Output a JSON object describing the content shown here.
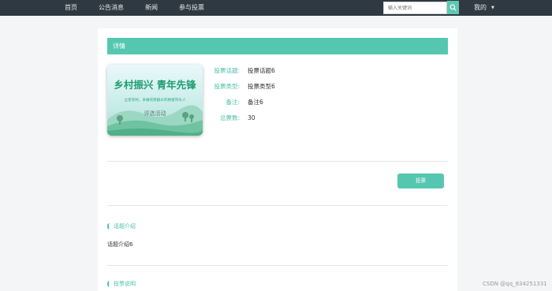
{
  "nav": {
    "items": [
      {
        "label": "首页"
      },
      {
        "label": "公告消息"
      },
      {
        "label": "新闻"
      },
      {
        "label": "参与投票"
      }
    ],
    "search_placeholder": "输入关键词",
    "search_icon": "search-icon",
    "mine_label": "我的",
    "mine_caret": "▼"
  },
  "detail": {
    "header": "详情",
    "cover": {
      "title": "乡村振兴 青年先锋",
      "subtitle": "立足农村，争做农民群众的致富带头人",
      "badge": "评选活动"
    },
    "fields": [
      {
        "key": "投票话题:",
        "value": "投票话题6"
      },
      {
        "key": "投票类型:",
        "value": "投票类型6"
      },
      {
        "key": "备注:",
        "value": "备注6"
      },
      {
        "key": "总票数:",
        "value": "30"
      }
    ],
    "vote_button": "投票"
  },
  "sections": [
    {
      "title": "话题介绍",
      "body": "话题介绍6"
    },
    {
      "title": "投票说明",
      "body": ""
    }
  ],
  "watermark": "CSDN @qq_834251331",
  "colors": {
    "accent": "#55c7b0",
    "nav_bg": "#2f3942",
    "page_bg": "#f4f5f7"
  }
}
